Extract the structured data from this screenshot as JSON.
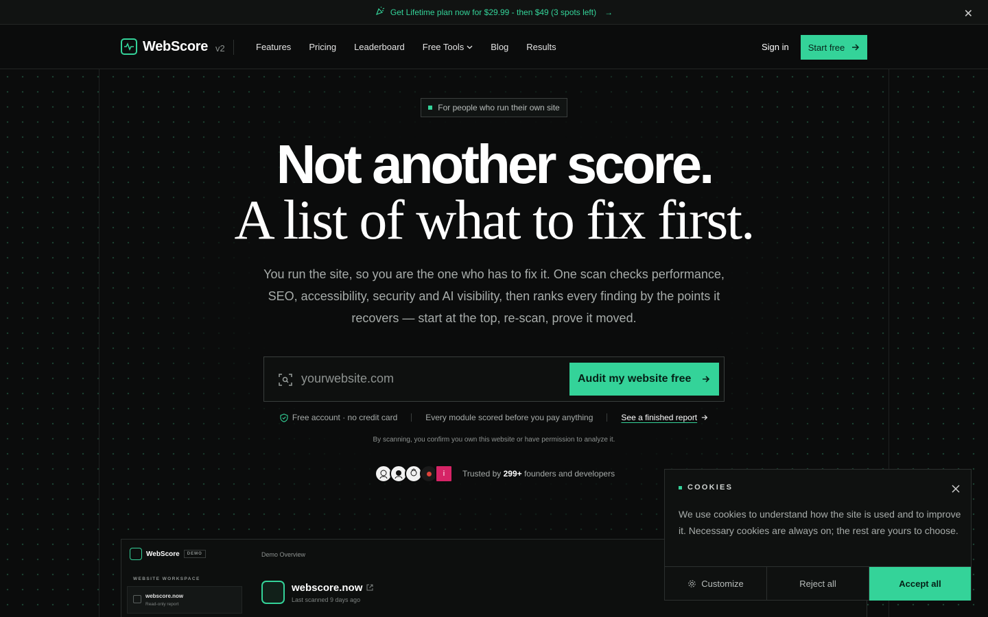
{
  "announcement": {
    "text": "Get Lifetime plan now for $29.99 - then $49 (3 spots left)",
    "arrow": "→",
    "close": "✕"
  },
  "nav": {
    "brand": "WebScore",
    "version": "v2",
    "links": [
      "Features",
      "Pricing",
      "Leaderboard",
      "Free Tools",
      "Blog",
      "Results"
    ],
    "sign_in": "Sign in",
    "start_free": "Start free"
  },
  "hero": {
    "badge": "For people who run their own site",
    "headline": "Not another score.",
    "headline2": "A list of what to fix first.",
    "subtitle": "You run the site, so you are the one who has to fix it. One scan checks performance, SEO, accessibility, security and AI visibility, then ranks every finding by the points it recovers — start at the top, re-scan, prove it moved.",
    "input_placeholder": "yourwebsite.com",
    "audit_button": "Audit my website free",
    "perks": [
      "Free account · no credit card",
      "Every module scored before you pay anything"
    ],
    "perk_link": "See a finished report",
    "consent": "By scanning, you confirm you own this website or have permission to analyze it.",
    "trusted_prefix": "Trusted by",
    "trusted_count": "299+",
    "trusted_suffix": "founders and developers",
    "avatar_letter": "i"
  },
  "demo": {
    "brand": "WebScore",
    "tag": "DEMO",
    "workspace_label": "WEBSITE WORKSPACE",
    "item_title": "webscore.now",
    "item_sub": "Read-only report",
    "overview": "Demo Overview",
    "site_name": "webscore.now",
    "last_scanned": "Last scanned 9 days ago"
  },
  "cookies": {
    "title": "COOKIES",
    "text": "We use cookies to understand how the site is used and to improve it. Necessary cookies are always on; the rest are yours to choose.",
    "customize": "Customize",
    "reject": "Reject all",
    "accept": "Accept all"
  },
  "colors": {
    "accent": "#34d399",
    "background": "#0b0c0c"
  }
}
